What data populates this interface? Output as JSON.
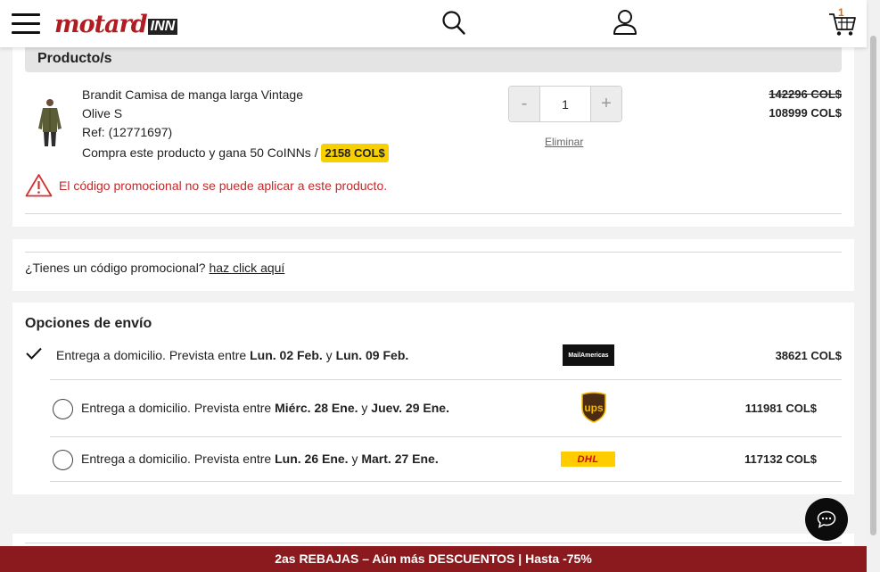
{
  "header": {
    "logo_main": "motard",
    "logo_suffix": "INN",
    "cart_count": "1"
  },
  "products": {
    "section_title": "Producto/s",
    "item": {
      "name_line1": "Brandit Camisa de manga larga Vintage",
      "name_line2": "Olive S",
      "ref": "Ref: (12771697)",
      "coins_text": "Compra este producto y gana 50 CoINNs / ",
      "coins_value": "2158 COL$",
      "quantity": "1",
      "qty_minus": "-",
      "qty_plus": "+",
      "remove_label": "Eliminar",
      "price_old": "142296 COL$",
      "price_new": "108999 COL$"
    },
    "promo_error": "El código promocional no se puede aplicar a este producto."
  },
  "promo": {
    "question": "¿Tienes un código promocional? ",
    "link": "haz click aquí"
  },
  "shipping": {
    "title": "Opciones de envío",
    "options": [
      {
        "prefix": "Entrega a domicilio. Prevista entre ",
        "date_from": "Lun. 02 Feb.",
        "joiner": " y ",
        "date_to": "Lun. 09 Feb.",
        "carrier": "MailAmericas",
        "price": "38621 COL$",
        "selected": true
      },
      {
        "prefix": "Entrega a domicilio. Prevista entre ",
        "date_from": "Miérc. 28 Ene.",
        "joiner": " y ",
        "date_to": "Juev. 29 Ene.",
        "carrier": "ups",
        "price": "111981 COL$",
        "selected": false
      },
      {
        "prefix": "Entrega a domicilio. Prevista entre ",
        "date_from": "Lun. 26 Ene.",
        "joiner": " y ",
        "date_to": "Mart. 27 Ene.",
        "carrier": "DHL",
        "price": "117132 COL$",
        "selected": false
      }
    ]
  },
  "banner": {
    "text": "2as REBAJAS – Aún más DESCUENTOS | Hasta -75%"
  },
  "colors": {
    "brand_red": "#b01c22",
    "banner_bg": "#8b1a1e",
    "coin_badge": "#f6d000",
    "error_red": "#c62828"
  }
}
